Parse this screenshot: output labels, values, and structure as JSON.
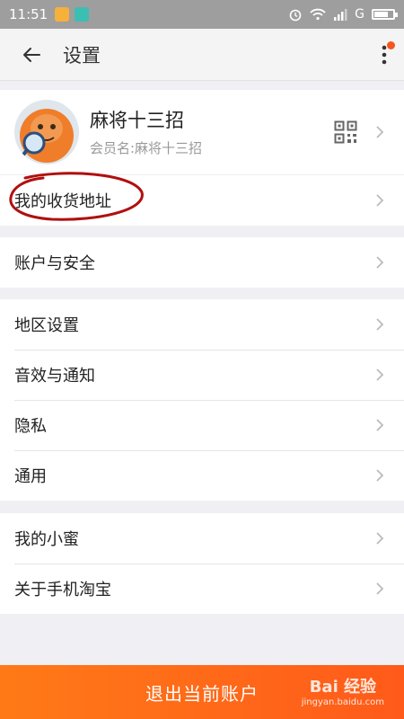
{
  "status_bar": {
    "time": "11:51",
    "network": "G"
  },
  "header": {
    "title": "设置"
  },
  "profile": {
    "name": "麻将十三招",
    "member_label": "会员名:麻将十三招"
  },
  "groups": [
    [
      "我的收货地址"
    ],
    [
      "账户与安全"
    ],
    [
      "地区设置",
      "音效与通知",
      "隐私",
      "通用"
    ],
    [
      "我的小蜜",
      "关于手机淘宝"
    ]
  ],
  "logout": {
    "label": "退出当前账户"
  },
  "watermark": {
    "brand": "Bai 经验",
    "url": "jingyan.baidu.com"
  },
  "colors": {
    "accent": "#ff6a17",
    "badge": "#f5561e",
    "annotation": "#b01010"
  }
}
